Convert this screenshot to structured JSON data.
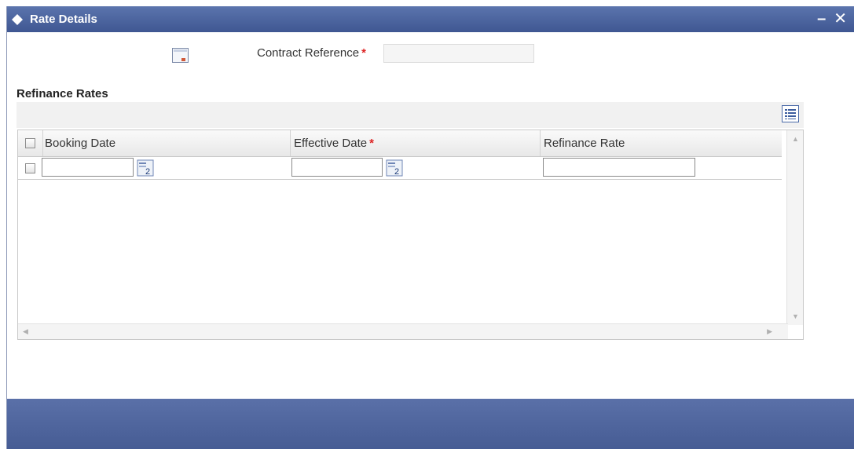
{
  "window": {
    "title": "Rate Details",
    "minimize_glyph": "–",
    "close_glyph": "✕"
  },
  "header": {
    "contract_reference_label": "Contract Reference",
    "required_mark": "*",
    "contract_reference_value": ""
  },
  "section": {
    "title": "Refinance Rates"
  },
  "grid": {
    "columns": [
      {
        "label": "Booking Date",
        "required": false
      },
      {
        "label": "Effective Date",
        "required": true
      },
      {
        "label": "Refinance Rate",
        "required": false
      }
    ],
    "rows": [
      {
        "booking_date": "",
        "effective_date": "",
        "refinance_rate": ""
      }
    ]
  },
  "icons": {
    "title": "diamond-icon",
    "contract_lookup": "document-lookup-icon",
    "grid_toolbar": "single-record-view-icon",
    "date_picker": "calendar-icon"
  },
  "colors": {
    "title_bar": "#4a62a0",
    "footer": "#4f66a0",
    "required": "#dd2222"
  }
}
